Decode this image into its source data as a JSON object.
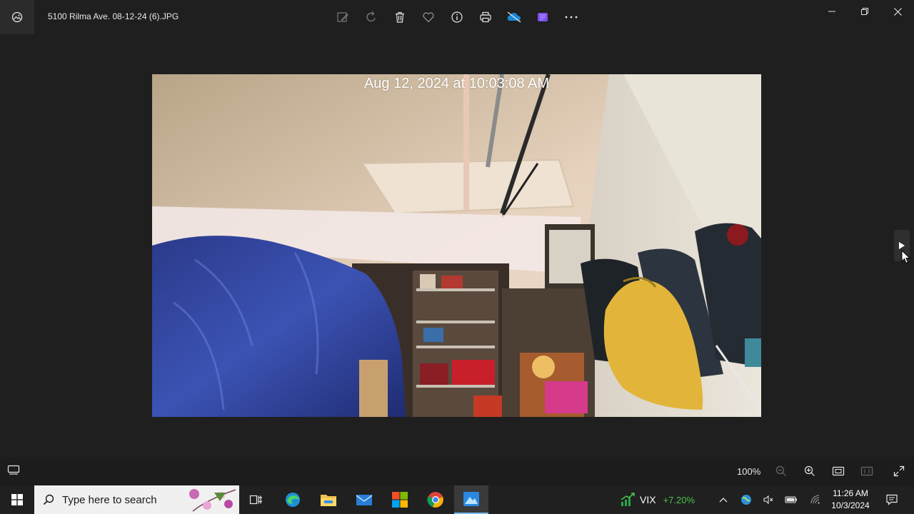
{
  "app": {
    "file_name": "5100 Rilma Ave. 08-12-24 (6).JPG",
    "icons": {
      "app": "photos-app-icon",
      "toolbar": [
        "edit-icon",
        "rotate-icon",
        "delete-icon",
        "favorite-icon",
        "info-icon",
        "print-icon",
        "onedrive-icon",
        "clipchamp-icon",
        "more-icon"
      ],
      "window": [
        "minimize-icon",
        "restore-icon",
        "close-icon"
      ]
    }
  },
  "photo": {
    "timestamp_overlay": "Aug 12, 2024 at 10:03:08 AM"
  },
  "bottombar": {
    "zoom_level": "100%"
  },
  "taskbar": {
    "search_placeholder": "Type here to search",
    "ticker_name": "VIX",
    "ticker_change": "+7.20%",
    "time": "11:26 AM",
    "date": "10/3/2024",
    "colors": {
      "ticker_up": "#4cc24c",
      "active_underline": "#76b9ed"
    }
  }
}
